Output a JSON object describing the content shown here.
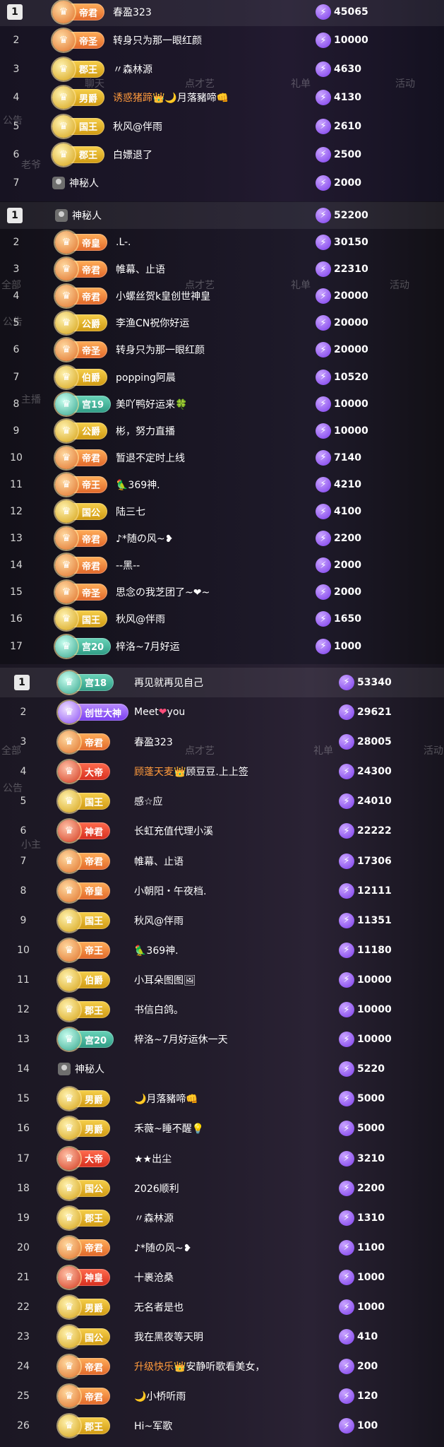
{
  "ghost_texts": [
    "聊天",
    "点才艺",
    "礼单",
    "活动",
    "全部",
    "公告",
    "老爷",
    "主播",
    "小主"
  ],
  "panels": [
    {
      "rows": [
        {
          "rank": "1",
          "badge": "帝君",
          "color": "orange",
          "name": "春盈323",
          "score": "45065"
        },
        {
          "rank": "2",
          "badge": "帝圣",
          "color": "orange",
          "name": "转身只为那一眼红颜",
          "score": "10000"
        },
        {
          "rank": "3",
          "badge": "郡王",
          "color": "gold",
          "name": "〃森林源",
          "score": "4630"
        },
        {
          "rank": "4",
          "badge": "男爵",
          "color": "gold",
          "name_parts": [
            {
              "t": "诱惑猪蹄",
              "c": "orange"
            },
            {
              "t": "👑🌙月落豬啼👊"
            }
          ],
          "score": "4130"
        },
        {
          "rank": "5",
          "badge": "国王",
          "color": "gold",
          "name": "秋风@伴雨",
          "score": "2610"
        },
        {
          "rank": "6",
          "badge": "郡王",
          "color": "gold",
          "name": "白嫖退了",
          "score": "2500"
        },
        {
          "rank": "7",
          "badge": "",
          "color": "none",
          "name": "神秘人",
          "score": "2000"
        }
      ]
    },
    {
      "rows": [
        {
          "rank": "1",
          "badge": "",
          "color": "none",
          "name": "神秘人",
          "score": "52200"
        },
        {
          "rank": "2",
          "badge": "帝皇",
          "color": "orange",
          "name": ".L-.",
          "score": "30150"
        },
        {
          "rank": "3",
          "badge": "帝君",
          "color": "orange",
          "name": "帷幕、止语",
          "score": "22310"
        },
        {
          "rank": "4",
          "badge": "帝君",
          "color": "orange",
          "name": "小螺丝贺k皇创世神皇",
          "score": "20000"
        },
        {
          "rank": "5",
          "badge": "公爵",
          "color": "gold",
          "name": "李渔CN祝你好运",
          "score": "20000"
        },
        {
          "rank": "6",
          "badge": "帝圣",
          "color": "orange",
          "name": "转身只为那一眼红颜",
          "score": "20000"
        },
        {
          "rank": "7",
          "badge": "伯爵",
          "color": "gold",
          "name": "popping阿晨",
          "score": "10520"
        },
        {
          "rank": "8",
          "badge": "宫19",
          "color": "teal",
          "name": "美吖鸭好运来🍀",
          "score": "10000"
        },
        {
          "rank": "9",
          "badge": "公爵",
          "color": "gold",
          "name": "彬，努力直播",
          "score": "10000"
        },
        {
          "rank": "10",
          "badge": "帝君",
          "color": "orange",
          "name": "暂退不定时上线",
          "score": "7140"
        },
        {
          "rank": "11",
          "badge": "帝王",
          "color": "orange",
          "name": "🦜369神.",
          "score": "4210"
        },
        {
          "rank": "12",
          "badge": "国公",
          "color": "gold",
          "name": "陆三七",
          "score": "4100"
        },
        {
          "rank": "13",
          "badge": "帝君",
          "color": "orange",
          "name": "♪*随の风~❥",
          "score": "2200"
        },
        {
          "rank": "14",
          "badge": "帝君",
          "color": "orange",
          "name": "--黑--",
          "score": "2000"
        },
        {
          "rank": "15",
          "badge": "帝圣",
          "color": "orange",
          "name": "思念の我芝团了~❤~",
          "score": "2000"
        },
        {
          "rank": "16",
          "badge": "国王",
          "color": "gold",
          "name": "秋风@伴雨",
          "score": "1650"
        },
        {
          "rank": "17",
          "badge": "宫20",
          "color": "teal",
          "name": "梓洛~7月好运",
          "score": "1000"
        }
      ]
    },
    {
      "rows": [
        {
          "rank": "1",
          "badge": "宫18",
          "color": "teal",
          "name": "再见就再见自己",
          "score": "53340"
        },
        {
          "rank": "2",
          "badge": "创世大神",
          "color": "purple",
          "name_parts": [
            {
              "t": "Meet "
            },
            {
              "t": "❤",
              "c": "red"
            },
            {
              "t": " you"
            }
          ],
          "score": "29621"
        },
        {
          "rank": "3",
          "badge": "帝君",
          "color": "orange",
          "name": "春盈323",
          "score": "28005"
        },
        {
          "rank": "4",
          "badge": "大帝",
          "color": "red",
          "name_parts": [
            {
              "t": "顾蓬天麦",
              "c": "orange"
            },
            {
              "t": "👑顾豆豆.上上签"
            }
          ],
          "score": "24300"
        },
        {
          "rank": "5",
          "badge": "国王",
          "color": "gold",
          "name": "感☆应",
          "score": "24010"
        },
        {
          "rank": "6",
          "badge": "神君",
          "color": "red",
          "name": "长虹充值代理小溪",
          "score": "22222"
        },
        {
          "rank": "7",
          "badge": "帝君",
          "color": "orange",
          "name": "帷幕、止语",
          "score": "17306"
        },
        {
          "rank": "8",
          "badge": "帝皇",
          "color": "orange",
          "name": "小朝阳・午夜档.",
          "score": "12111"
        },
        {
          "rank": "9",
          "badge": "国王",
          "color": "gold",
          "name": "秋风@伴雨",
          "score": "11351"
        },
        {
          "rank": "10",
          "badge": "帝王",
          "color": "orange",
          "name": "🦜369神.",
          "score": "11180"
        },
        {
          "rank": "11",
          "badge": "伯爵",
          "color": "gold",
          "name": "小耳朵图图🖼",
          "score": "10000"
        },
        {
          "rank": "12",
          "badge": "郡王",
          "color": "gold",
          "name": "书信白鸽。",
          "score": "10000"
        },
        {
          "rank": "13",
          "badge": "宫20",
          "color": "teal",
          "name": "梓洛~7月好运休一天",
          "score": "10000"
        },
        {
          "rank": "14",
          "badge": "",
          "color": "none",
          "name": "神秘人",
          "score": "5220"
        },
        {
          "rank": "15",
          "badge": "男爵",
          "color": "gold",
          "name": "🌙月落豬啼👊",
          "score": "5000"
        },
        {
          "rank": "16",
          "badge": "男爵",
          "color": "gold",
          "name": "禾薇~睡不醒💡",
          "score": "5000"
        },
        {
          "rank": "17",
          "badge": "大帝",
          "color": "red",
          "name": "★★出尘",
          "score": "3210"
        },
        {
          "rank": "18",
          "badge": "国公",
          "color": "gold",
          "name": "2026顺利",
          "score": "2200"
        },
        {
          "rank": "19",
          "badge": "郡王",
          "color": "gold",
          "name": "〃森林源",
          "score": "1310"
        },
        {
          "rank": "20",
          "badge": "帝君",
          "color": "orange",
          "name": "♪*随の风~❥",
          "score": "1100"
        },
        {
          "rank": "21",
          "badge": "神皇",
          "color": "red",
          "name": "十裹沧桑",
          "score": "1000"
        },
        {
          "rank": "22",
          "badge": "男爵",
          "color": "gold",
          "name": "无名者是也",
          "score": "1000"
        },
        {
          "rank": "23",
          "badge": "国公",
          "color": "gold",
          "name": "我在黑夜等天明",
          "score": "410"
        },
        {
          "rank": "24",
          "badge": "帝君",
          "color": "orange",
          "name_parts": [
            {
              "t": "升级快乐",
              "c": "orange"
            },
            {
              "t": "👑安静听歌看美女，"
            }
          ],
          "score": "200"
        },
        {
          "rank": "25",
          "badge": "帝君",
          "color": "orange",
          "name": "🌙小桥听雨",
          "score": "120"
        },
        {
          "rank": "26",
          "badge": "郡王",
          "color": "gold",
          "name": "Hi~军歌",
          "score": "100"
        }
      ]
    }
  ],
  "bolt_glyph": "⚡",
  "emblem_glyph": "♛",
  "colors": {
    "orange_text": "#ff9a3c",
    "bolt_purple": "#7c3dea",
    "red_heart": "#ff4d7a"
  }
}
